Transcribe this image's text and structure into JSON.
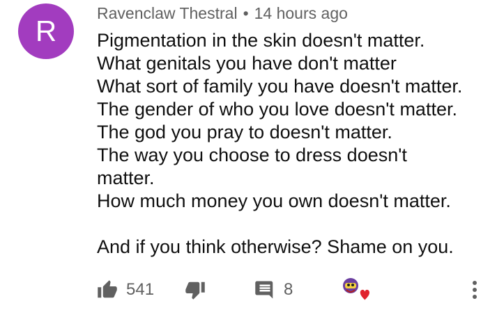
{
  "comment": {
    "author": {
      "name": "Ravenclaw Thestral",
      "avatar_initial": "R",
      "avatar_color": "#a23cbf"
    },
    "separator": "•",
    "timestamp": "14 hours ago",
    "lines": [
      "Pigmentation in the skin doesn't matter.",
      "What genitals you have don't matter",
      "What sort of family you have doesn't matter.",
      "The gender of who you love doesn't matter.",
      "The god you pray to doesn't matter.",
      "The way you choose to dress doesn't",
      "matter.",
      "How much money you own doesn't matter.",
      "",
      "And if you think otherwise? Shame on you."
    ],
    "actions": {
      "like_count": "541",
      "reply_count": "8",
      "heart_color": "#e0232e"
    }
  }
}
